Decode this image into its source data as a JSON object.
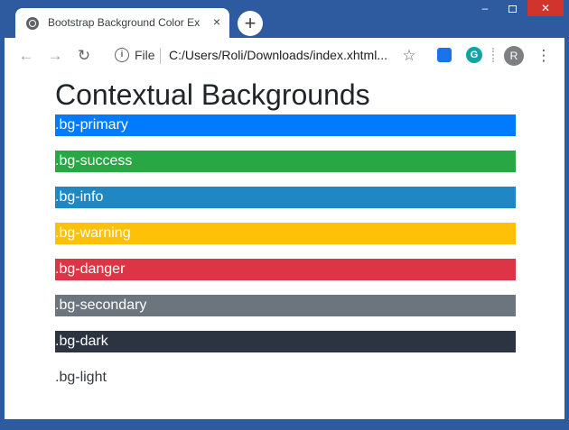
{
  "browser": {
    "tab_title": "Bootstrap Background Color Ex",
    "tab_close": "×",
    "new_tab": "+",
    "file_label": "File",
    "url": "C:/Users/Roli/Downloads/index.xhtml...",
    "avatar_letter": "R",
    "window_controls": {
      "minimize": "–",
      "close": "✕"
    }
  },
  "page": {
    "heading": "Contextual Backgrounds",
    "rows": [
      {
        "label": ".bg-primary",
        "color": "#007bff",
        "text_color": "#ffffff"
      },
      {
        "label": ".bg-success",
        "color": "#28a745",
        "text_color": "#ffffff"
      },
      {
        "label": ".bg-info",
        "color": "#1f88c4",
        "text_color": "#ffffff"
      },
      {
        "label": ".bg-warning",
        "color": "#ffc107",
        "text_color": "#ffffff"
      },
      {
        "label": ".bg-danger",
        "color": "#dc3545",
        "text_color": "#ffffff"
      },
      {
        "label": ".bg-secondary",
        "color": "#6c757d",
        "text_color": "#ffffff"
      },
      {
        "label": ".bg-dark",
        "color": "#2d3441",
        "text_color": "#ffffff"
      },
      {
        "label": ".bg-light",
        "color": "#ffffff",
        "text_color": "#343a40"
      }
    ]
  }
}
